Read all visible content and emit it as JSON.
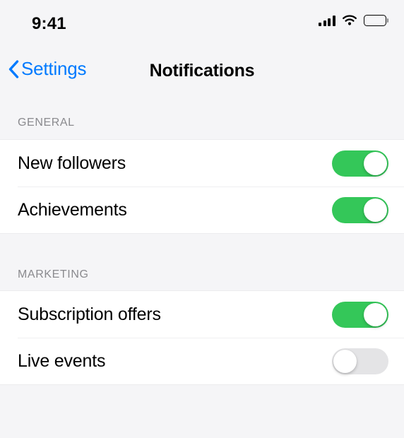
{
  "status_bar": {
    "time": "9:41",
    "cellular_icon": "signal-bars-icon",
    "cellular_bars": 4,
    "wifi_icon": "wifi-icon",
    "battery_icon": "battery-full-icon",
    "battery_level": 100
  },
  "nav_bar": {
    "back_icon": "chevron-left-icon",
    "back_label": "Settings",
    "title": "Notifications",
    "accent_color": "#007AFF"
  },
  "colors": {
    "background": "#f5f5f7",
    "row_background": "#ffffff",
    "toggle_on": "#34C759",
    "toggle_off": "#e4e4e6",
    "header_text": "#8a8a8e",
    "separator": "#efeff1"
  },
  "sections": [
    {
      "header": "GENERAL",
      "rows": [
        {
          "label": "New followers",
          "toggle_state": "on",
          "toggle_value": "enabled"
        },
        {
          "label": "Achievements",
          "toggle_state": "on",
          "toggle_value": "enabled"
        }
      ]
    },
    {
      "header": "MARKETING",
      "rows": [
        {
          "label": "Subscription offers",
          "toggle_state": "on",
          "toggle_value": "enabled"
        },
        {
          "label": "Live events",
          "toggle_state": "off",
          "toggle_value": "disabled"
        }
      ]
    }
  ]
}
